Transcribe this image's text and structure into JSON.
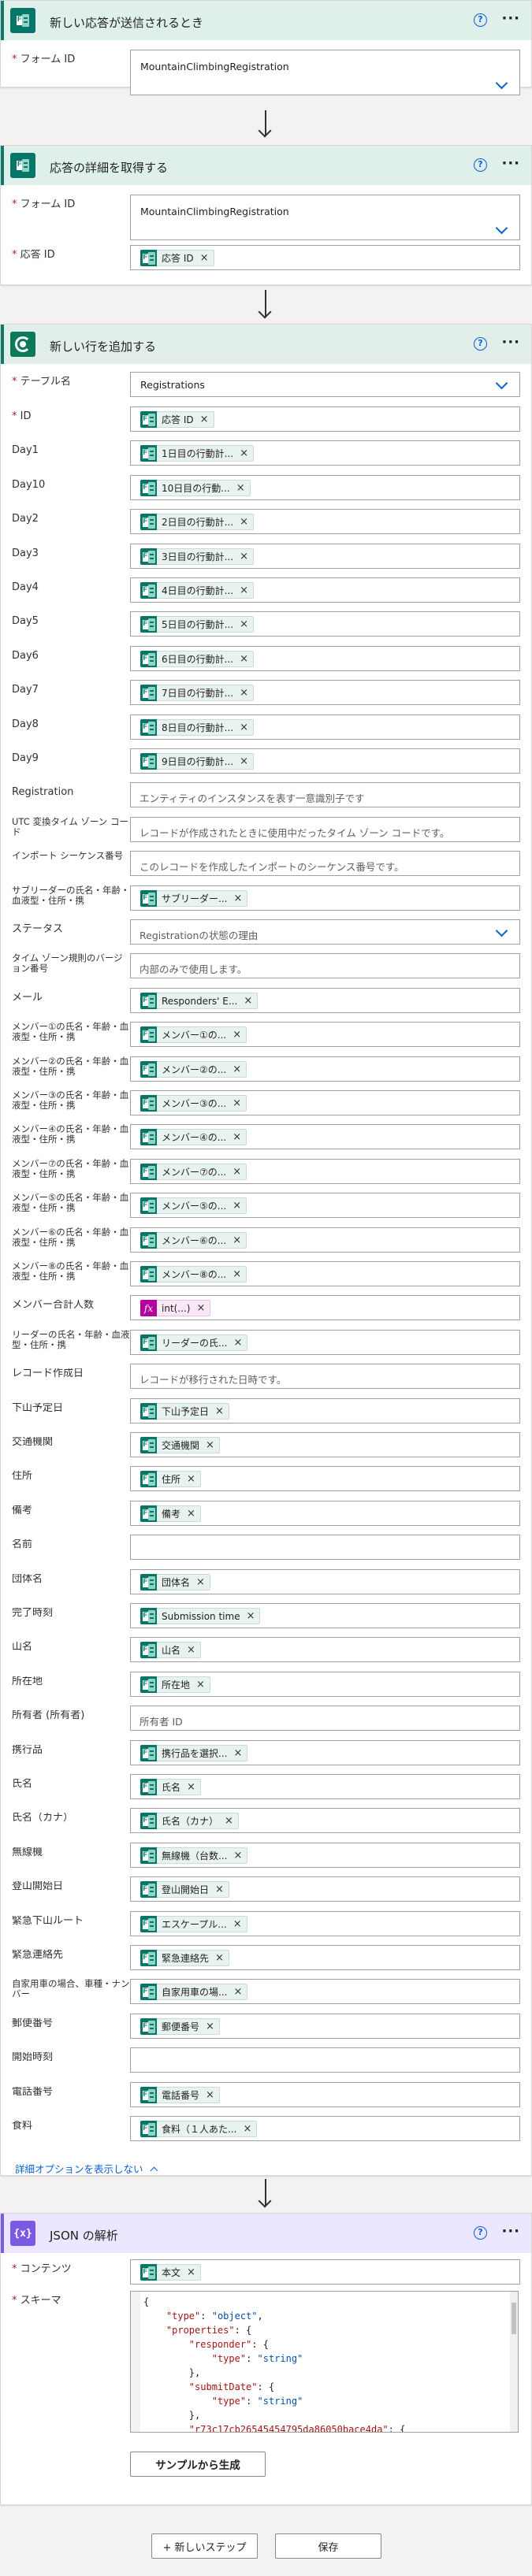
{
  "trigger": {
    "title": "新しい応答が送信されるとき",
    "form_id_label": "フォーム ID",
    "form_id_value": "MountainClimbingRegistration"
  },
  "get_details": {
    "title": "応答の詳細を取得する",
    "form_id_label": "フォーム ID",
    "form_id_value": "MountainClimbingRegistration",
    "response_id_label": "応答 ID",
    "response_id_token": "応答 ID"
  },
  "add_row": {
    "title": "新しい行を追加する",
    "table_label": "テーブル名",
    "table_value": "Registrations",
    "fields": [
      {
        "label": "ID",
        "required": true,
        "token": "応答 ID",
        "icon": "forms-icon"
      },
      {
        "label": "Day1",
        "token": "1日目の行動計...",
        "icon": "forms-icon"
      },
      {
        "label": "Day10",
        "token": "10日目の行動...",
        "icon": "forms-icon"
      },
      {
        "label": "Day2",
        "token": "2日目の行動計...",
        "icon": "forms-icon"
      },
      {
        "label": "Day3",
        "token": "3日目の行動計...",
        "icon": "forms-icon"
      },
      {
        "label": "Day4",
        "token": "4日目の行動計...",
        "icon": "forms-icon"
      },
      {
        "label": "Day5",
        "token": "5日目の行動計...",
        "icon": "forms-icon"
      },
      {
        "label": "Day6",
        "token": "6日目の行動計...",
        "icon": "forms-icon"
      },
      {
        "label": "Day7",
        "token": "7日目の行動計...",
        "icon": "forms-icon"
      },
      {
        "label": "Day8",
        "token": "8日目の行動計...",
        "icon": "forms-icon"
      },
      {
        "label": "Day9",
        "token": "9日目の行動計...",
        "icon": "forms-icon"
      },
      {
        "label": "Registration",
        "placeholder": "エンティティのインスタンスを表す一意識別子です"
      },
      {
        "label": "UTC 変換タイム ゾーン コード",
        "placeholder": "レコードが作成されたときに使用中だったタイム ゾーン コードです。"
      },
      {
        "label": "インポート シーケンス番号",
        "placeholder": "このレコードを作成したインポートのシーケンス番号です。"
      },
      {
        "label": "サブリーダーの氏名・年齢・血液型・住所・携",
        "token": "サブリーダー...",
        "icon": "forms-icon"
      },
      {
        "label": "ステータス",
        "placeholder": "Registrationの状態の理由",
        "dropdown": true
      },
      {
        "label": "タイム ゾーン規則のバージョン番号",
        "placeholder": "内部のみで使用します。"
      },
      {
        "label": "メール",
        "token": "Responders' E...",
        "icon": "forms-icon"
      },
      {
        "label": "メンバー①の氏名・年齢・血液型・住所・携",
        "token": "メンバー①の...",
        "icon": "forms-icon"
      },
      {
        "label": "メンバー②の氏名・年齢・血液型・住所・携",
        "token": "メンバー②の...",
        "icon": "forms-icon"
      },
      {
        "label": "メンバー③の氏名・年齢・血液型・住所・携",
        "token": "メンバー③の...",
        "icon": "forms-icon"
      },
      {
        "label": "メンバー④の氏名・年齢・血液型・住所・携",
        "token": "メンバー④の...",
        "icon": "forms-icon"
      },
      {
        "label": "メンバー⑦の氏名・年齢・血液型・住所・携",
        "token": "メンバー⑦の...",
        "icon": "forms-icon"
      },
      {
        "label": "メンバー⑤の氏名・年齢・血液型・住所・携",
        "token": "メンバー⑤の...",
        "icon": "forms-icon"
      },
      {
        "label": "メンバー⑥の氏名・年齢・血液型・住所・携",
        "token": "メンバー⑥の...",
        "icon": "forms-icon"
      },
      {
        "label": "メンバー⑧の氏名・年齢・血液型・住所・携",
        "token": "メンバー⑧の...",
        "icon": "forms-icon"
      },
      {
        "label": "メンバー合計人数",
        "token": "int(...)",
        "icon": "fx-icon"
      },
      {
        "label": "リーダーの氏名・年齢・血液型・住所・携",
        "token": "リーダーの氏...",
        "icon": "forms-icon"
      },
      {
        "label": "レコード作成日",
        "placeholder": "レコードが移行された日時です。"
      },
      {
        "label": "下山予定日",
        "token": "下山予定日",
        "icon": "forms-icon"
      },
      {
        "label": "交通機関",
        "token": "交通機関",
        "icon": "forms-icon"
      },
      {
        "label": "住所",
        "token": "住所",
        "icon": "forms-icon"
      },
      {
        "label": "備考",
        "token": "備考",
        "icon": "forms-icon"
      },
      {
        "label": "名前"
      },
      {
        "label": "団体名",
        "token": "団体名",
        "icon": "forms-icon"
      },
      {
        "label": "完了時刻",
        "token": "Submission time",
        "icon": "forms-icon"
      },
      {
        "label": "山名",
        "token": "山名",
        "icon": "forms-icon"
      },
      {
        "label": "所在地",
        "token": "所在地",
        "icon": "forms-icon"
      },
      {
        "label": "所有者 (所有者)",
        "placeholder": "所有者 ID"
      },
      {
        "label": "携行品",
        "token": "携行品を選択...",
        "icon": "forms-icon"
      },
      {
        "label": "氏名",
        "token": "氏名",
        "icon": "forms-icon"
      },
      {
        "label": "氏名（カナ）",
        "token": "氏名（カナ）",
        "icon": "forms-icon"
      },
      {
        "label": "無線機",
        "token": "無線機（台数...",
        "icon": "forms-icon"
      },
      {
        "label": "登山開始日",
        "token": "登山開始日",
        "icon": "forms-icon"
      },
      {
        "label": "緊急下山ルート",
        "token": "エスケープル...",
        "icon": "forms-icon"
      },
      {
        "label": "緊急連絡先",
        "token": "緊急連絡先",
        "icon": "forms-icon"
      },
      {
        "label": "自家用車の場合、車種・ナンバー",
        "token": "自家用車の場...",
        "icon": "forms-icon"
      },
      {
        "label": "郵便番号",
        "token": "郵便番号",
        "icon": "forms-icon"
      },
      {
        "label": "開始時刻"
      },
      {
        "label": "電話番号",
        "token": "電話番号",
        "icon": "forms-icon"
      },
      {
        "label": "食料",
        "token": "食料（１人あた...",
        "icon": "forms-icon"
      }
    ],
    "advanced_link": "詳細オプションを表示しない"
  },
  "parse_json": {
    "title": "JSON の解析",
    "content_label": "コンテンツ",
    "content_token": "本文",
    "schema_label": "スキーマ",
    "schema_text": "{\n    \"type\": \"object\",\n    \"properties\": {\n        \"responder\": {\n            \"type\": \"string\"\n        },\n        \"submitDate\": {\n            \"type\": \"string\"\n        },\n        \"r73c17cb26545454795da86050bace4da\": {",
    "sample_button": "サンプルから生成"
  },
  "footer": {
    "new_step": "+ 新しいステップ",
    "save": "保存"
  },
  "icons": {
    "help": "?",
    "more": "···",
    "remove": "×",
    "fx": "fx",
    "json": "{x}"
  },
  "colors": {
    "forms_green": "#077568",
    "link_blue": "#0a5fd0",
    "json_purple": "#7b5ae5",
    "expression_pink": "#b4009e"
  }
}
